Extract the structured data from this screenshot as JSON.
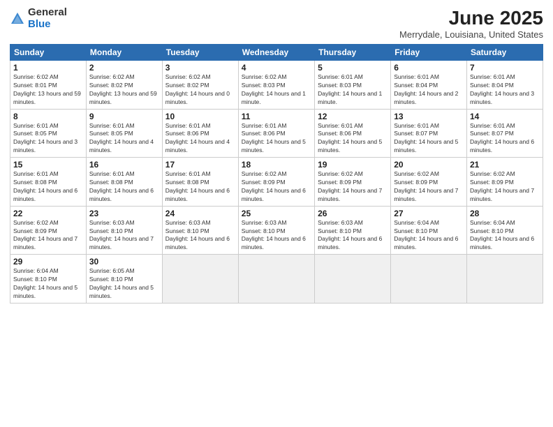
{
  "header": {
    "logo_general": "General",
    "logo_blue": "Blue",
    "month_title": "June 2025",
    "location": "Merrydale, Louisiana, United States"
  },
  "days_of_week": [
    "Sunday",
    "Monday",
    "Tuesday",
    "Wednesday",
    "Thursday",
    "Friday",
    "Saturday"
  ],
  "weeks": [
    [
      {
        "day": "1",
        "sunrise": "6:02 AM",
        "sunset": "8:01 PM",
        "daylight": "13 hours and 59 minutes."
      },
      {
        "day": "2",
        "sunrise": "6:02 AM",
        "sunset": "8:02 PM",
        "daylight": "13 hours and 59 minutes."
      },
      {
        "day": "3",
        "sunrise": "6:02 AM",
        "sunset": "8:02 PM",
        "daylight": "14 hours and 0 minutes."
      },
      {
        "day": "4",
        "sunrise": "6:02 AM",
        "sunset": "8:03 PM",
        "daylight": "14 hours and 1 minute."
      },
      {
        "day": "5",
        "sunrise": "6:01 AM",
        "sunset": "8:03 PM",
        "daylight": "14 hours and 1 minute."
      },
      {
        "day": "6",
        "sunrise": "6:01 AM",
        "sunset": "8:04 PM",
        "daylight": "14 hours and 2 minutes."
      },
      {
        "day": "7",
        "sunrise": "6:01 AM",
        "sunset": "8:04 PM",
        "daylight": "14 hours and 3 minutes."
      }
    ],
    [
      {
        "day": "8",
        "sunrise": "6:01 AM",
        "sunset": "8:05 PM",
        "daylight": "14 hours and 3 minutes."
      },
      {
        "day": "9",
        "sunrise": "6:01 AM",
        "sunset": "8:05 PM",
        "daylight": "14 hours and 4 minutes."
      },
      {
        "day": "10",
        "sunrise": "6:01 AM",
        "sunset": "8:06 PM",
        "daylight": "14 hours and 4 minutes."
      },
      {
        "day": "11",
        "sunrise": "6:01 AM",
        "sunset": "8:06 PM",
        "daylight": "14 hours and 5 minutes."
      },
      {
        "day": "12",
        "sunrise": "6:01 AM",
        "sunset": "8:06 PM",
        "daylight": "14 hours and 5 minutes."
      },
      {
        "day": "13",
        "sunrise": "6:01 AM",
        "sunset": "8:07 PM",
        "daylight": "14 hours and 5 minutes."
      },
      {
        "day": "14",
        "sunrise": "6:01 AM",
        "sunset": "8:07 PM",
        "daylight": "14 hours and 6 minutes."
      }
    ],
    [
      {
        "day": "15",
        "sunrise": "6:01 AM",
        "sunset": "8:08 PM",
        "daylight": "14 hours and 6 minutes."
      },
      {
        "day": "16",
        "sunrise": "6:01 AM",
        "sunset": "8:08 PM",
        "daylight": "14 hours and 6 minutes."
      },
      {
        "day": "17",
        "sunrise": "6:01 AM",
        "sunset": "8:08 PM",
        "daylight": "14 hours and 6 minutes."
      },
      {
        "day": "18",
        "sunrise": "6:02 AM",
        "sunset": "8:09 PM",
        "daylight": "14 hours and 6 minutes."
      },
      {
        "day": "19",
        "sunrise": "6:02 AM",
        "sunset": "8:09 PM",
        "daylight": "14 hours and 7 minutes."
      },
      {
        "day": "20",
        "sunrise": "6:02 AM",
        "sunset": "8:09 PM",
        "daylight": "14 hours and 7 minutes."
      },
      {
        "day": "21",
        "sunrise": "6:02 AM",
        "sunset": "8:09 PM",
        "daylight": "14 hours and 7 minutes."
      }
    ],
    [
      {
        "day": "22",
        "sunrise": "6:02 AM",
        "sunset": "8:09 PM",
        "daylight": "14 hours and 7 minutes."
      },
      {
        "day": "23",
        "sunrise": "6:03 AM",
        "sunset": "8:10 PM",
        "daylight": "14 hours and 7 minutes."
      },
      {
        "day": "24",
        "sunrise": "6:03 AM",
        "sunset": "8:10 PM",
        "daylight": "14 hours and 6 minutes."
      },
      {
        "day": "25",
        "sunrise": "6:03 AM",
        "sunset": "8:10 PM",
        "daylight": "14 hours and 6 minutes."
      },
      {
        "day": "26",
        "sunrise": "6:03 AM",
        "sunset": "8:10 PM",
        "daylight": "14 hours and 6 minutes."
      },
      {
        "day": "27",
        "sunrise": "6:04 AM",
        "sunset": "8:10 PM",
        "daylight": "14 hours and 6 minutes."
      },
      {
        "day": "28",
        "sunrise": "6:04 AM",
        "sunset": "8:10 PM",
        "daylight": "14 hours and 6 minutes."
      }
    ],
    [
      {
        "day": "29",
        "sunrise": "6:04 AM",
        "sunset": "8:10 PM",
        "daylight": "14 hours and 5 minutes."
      },
      {
        "day": "30",
        "sunrise": "6:05 AM",
        "sunset": "8:10 PM",
        "daylight": "14 hours and 5 minutes."
      },
      null,
      null,
      null,
      null,
      null
    ]
  ]
}
